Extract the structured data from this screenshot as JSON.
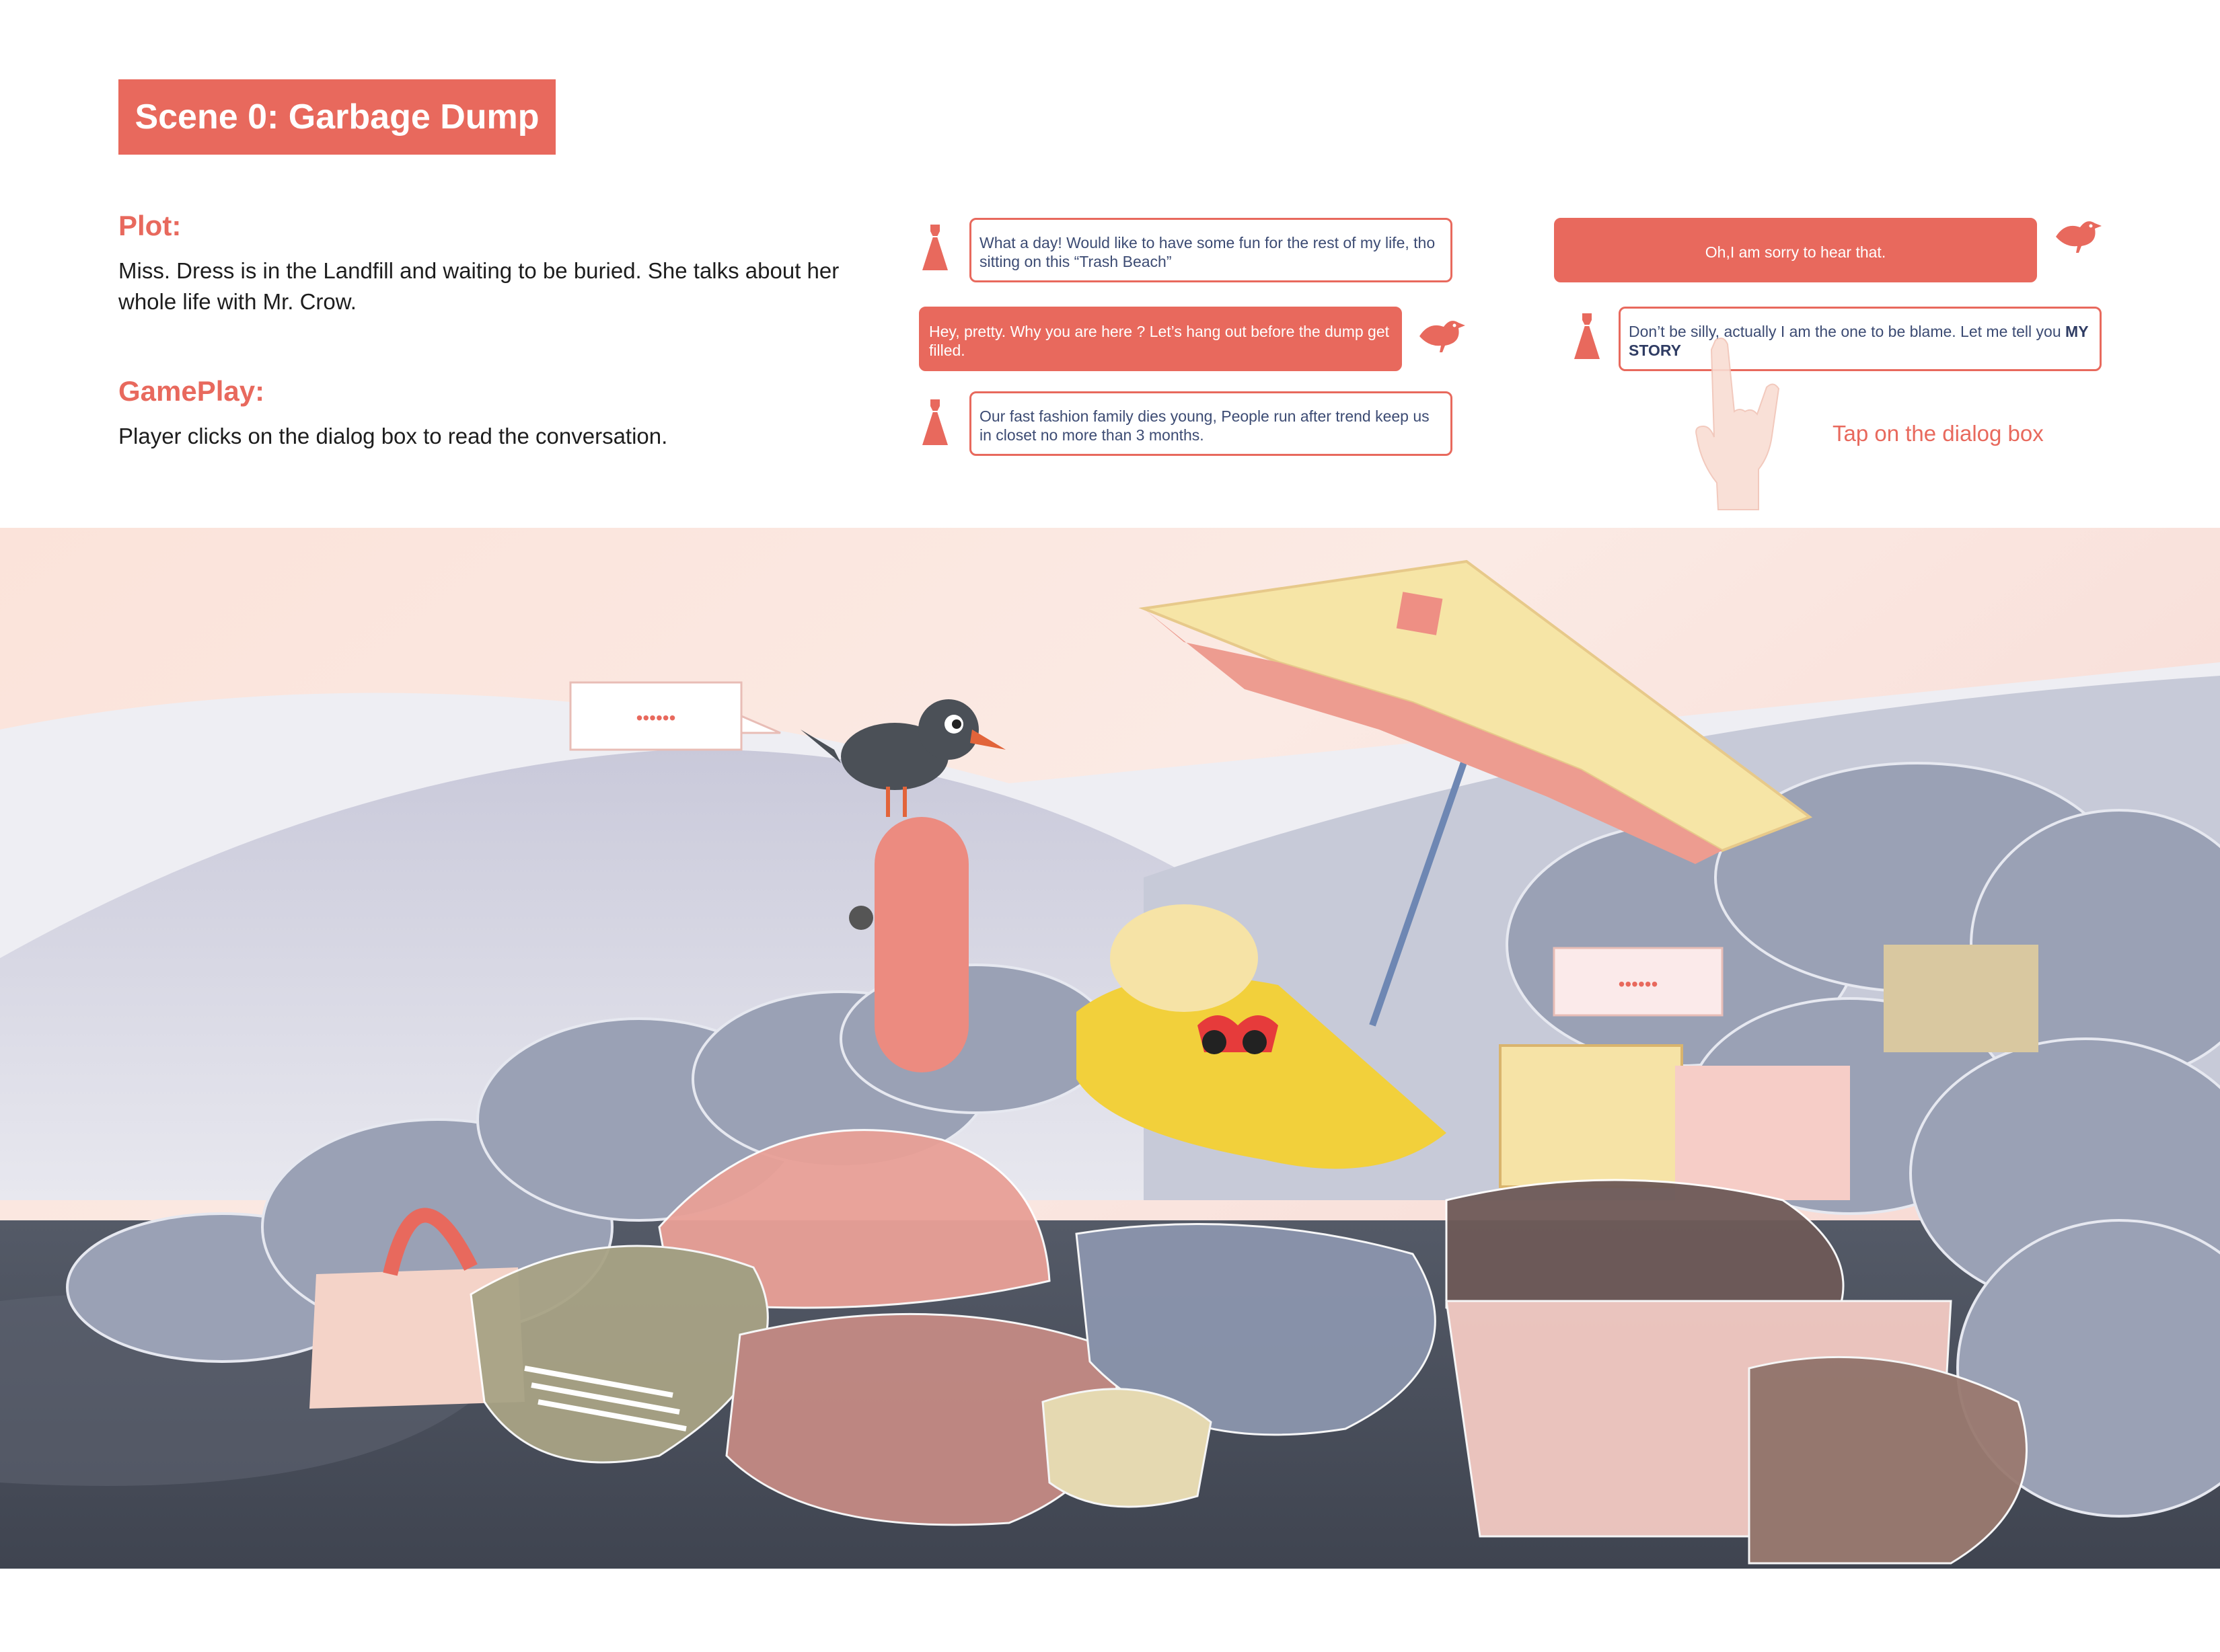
{
  "header": {
    "title": "Scene 0: Garbage Dump"
  },
  "plot": {
    "heading": "Plot:",
    "text": "Miss. Dress is in the Landfill and waiting to be buried. She talks about her whole life with Mr. Crow."
  },
  "gameplay": {
    "heading": "GamePlay:",
    "text": "Player clicks on the dialog box to read the conversation."
  },
  "dialogs": {
    "d1": "What a day! Would like to have some fun for the rest of my life, tho sitting on this “Trash Beach”",
    "d2": "Hey, pretty. Why you are here ? Let’s hang out before the dump get filled.",
    "d3": "Our fast fashion family  dies young, People run after trend keep us in closet no more than 3 months.",
    "d4": "Oh,I am sorry to hear that.",
    "d5_text": "Don’t be silly, actually I am the one to be blame. Let me tell you ",
    "d5_bold": "MY STORY"
  },
  "hint": {
    "text": "Tap on the dialog box"
  },
  "scene": {
    "crow_bubble": "••••••",
    "dress_bubble": "••••••"
  },
  "colors": {
    "accent": "#e8695d",
    "dialog_text": "#3c4b73",
    "crow": "#4b5057",
    "umbrella": "#f6e5a6"
  },
  "icons": [
    "dress-icon",
    "crow-icon",
    "tap-hand-icon"
  ]
}
